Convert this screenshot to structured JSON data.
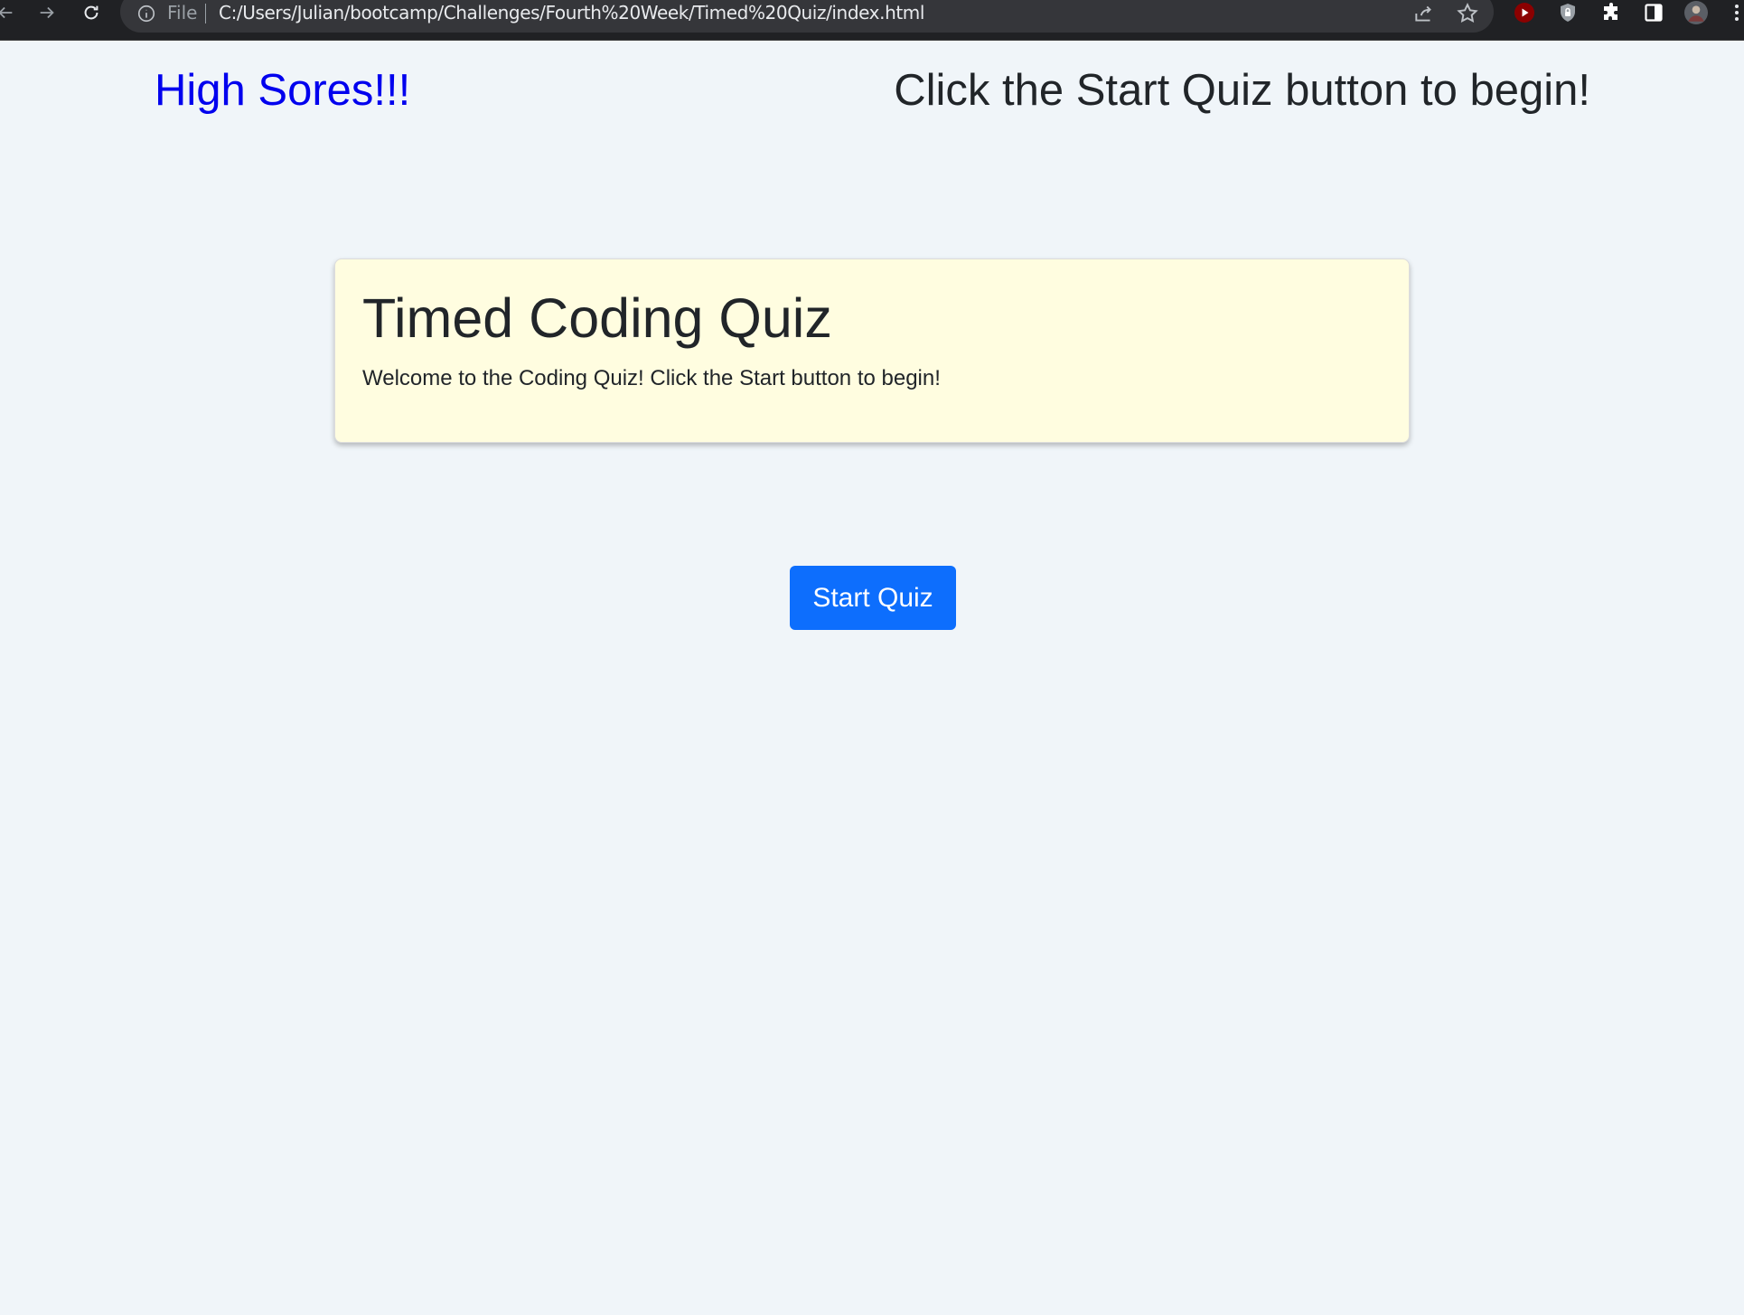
{
  "browser": {
    "scheme_label": "File",
    "url": "C:/Users/Julian/bootcamp/Challenges/Fourth%20Week/Timed%20Quiz/index.html",
    "icons": [
      "back-icon",
      "forward-icon",
      "reload-icon",
      "info-icon",
      "share-icon",
      "star-icon",
      "youtube-extension-icon",
      "shield-extension-icon",
      "extensions-puzzle-icon",
      "side-panel-icon",
      "profile-avatar"
    ]
  },
  "header": {
    "high_scores_link": "High Sores!!!",
    "instructions": "Click the Start Quiz button to begin!"
  },
  "card": {
    "title": "Timed Coding Quiz",
    "text": "Welcome to the Coding Quiz! Click the Start button to begin!"
  },
  "actions": {
    "start_label": "Start Quiz"
  },
  "colors": {
    "page_background": "#f0f5f9",
    "card_background": "#fffde0",
    "link": "#0000ee",
    "button": "#0d6efd"
  }
}
